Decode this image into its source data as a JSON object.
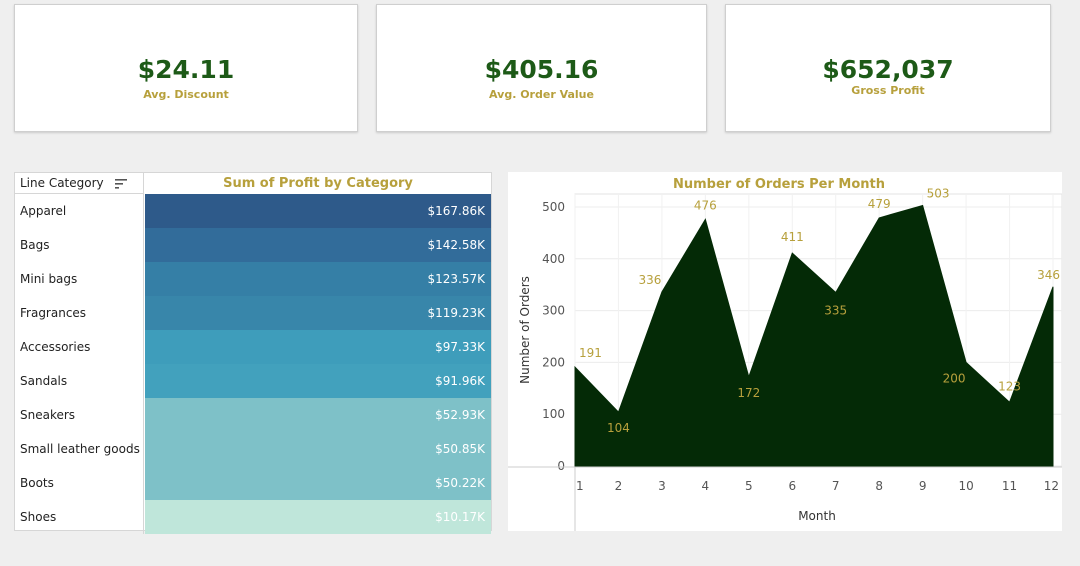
{
  "kpis": [
    {
      "value": "$24.11",
      "label": "Avg. Discount"
    },
    {
      "value": "$405.16",
      "label": "Avg. Order Value"
    },
    {
      "value": "$652,037",
      "label": "Gross Profit"
    }
  ],
  "colors": {
    "kpi_value": "#1d5a17",
    "gold": "#b7a03c",
    "area_fill": "#042a06"
  },
  "chart_data": [
    {
      "type": "table",
      "title": "Sum of Profit by Category",
      "row_header": "Line Category",
      "sort_icon": "sort-descending-icon",
      "rows": [
        {
          "category": "Apparel",
          "profit": 167.86,
          "label": "$167.86K",
          "color": "#2e5a8a"
        },
        {
          "category": "Bags",
          "profit": 142.58,
          "label": "$142.58K",
          "color": "#326c9a"
        },
        {
          "category": "Mini bags",
          "profit": 123.57,
          "label": "$123.57K",
          "color": "#357fa6"
        },
        {
          "category": "Fragrances",
          "profit": 119.23,
          "label": "$119.23K",
          "color": "#3886aa"
        },
        {
          "category": "Accessories",
          "profit": 97.33,
          "label": "$97.33K",
          "color": "#3e9dbb"
        },
        {
          "category": "Sandals",
          "profit": 91.96,
          "label": "$91.96K",
          "color": "#42a1bd"
        },
        {
          "category": "Sneakers",
          "profit": 52.93,
          "label": "$52.93K",
          "color": "#7ec1c8"
        },
        {
          "category": "Small leather goods",
          "profit": 50.85,
          "label": "$50.85K",
          "color": "#7ec1c8"
        },
        {
          "category": "Boots",
          "profit": 50.22,
          "label": "$50.22K",
          "color": "#7ec1c8"
        },
        {
          "category": "Shoes",
          "profit": 10.17,
          "label": "$10.17K",
          "color": "#bfe6da"
        }
      ]
    },
    {
      "type": "area",
      "title": "Number of Orders Per Month",
      "xlabel": "Month",
      "ylabel": "Number of Orders",
      "x": [
        1,
        2,
        3,
        4,
        5,
        6,
        7,
        8,
        9,
        10,
        11,
        12
      ],
      "values": [
        191,
        104,
        336,
        476,
        172,
        411,
        335,
        479,
        503,
        200,
        123,
        346
      ],
      "yticks": [
        0,
        100,
        200,
        300,
        400,
        500
      ],
      "ylim": [
        0,
        530
      ],
      "grid": true
    }
  ]
}
